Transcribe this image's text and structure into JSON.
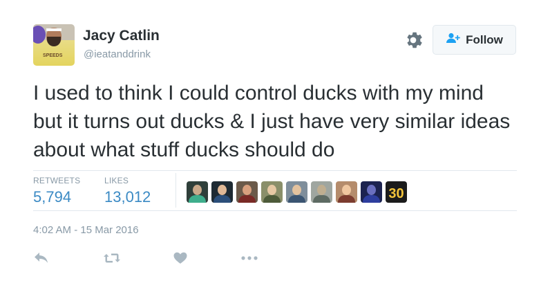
{
  "user": {
    "name": "Jacy Catlin",
    "handle": "@ieatanddrink",
    "avatar_shirt_text": "SPEEDS"
  },
  "header": {
    "follow_label": "Follow",
    "settings_icon": "gear-icon",
    "follow_icon": "add-user-icon"
  },
  "tweet": {
    "text": "I used to think I could control ducks with my mind but it turns out ducks & I just have very similar ideas about what stuff ducks should do"
  },
  "stats": {
    "retweets_label": "RETWEETS",
    "retweets_value": "5,794",
    "likes_label": "LIKES",
    "likes_value": "13,012"
  },
  "likers": {
    "count": 9,
    "jersey_number": "30"
  },
  "timestamp": "4:02 AM - 15 Mar 2016",
  "actions": [
    "reply-icon",
    "retweet-icon",
    "like-icon",
    "more-icon"
  ],
  "colors": {
    "link_blue": "#3b8ac4",
    "meta_gray": "#8899a6",
    "text": "#292f33",
    "follow_icon_blue": "#1da1f2"
  }
}
